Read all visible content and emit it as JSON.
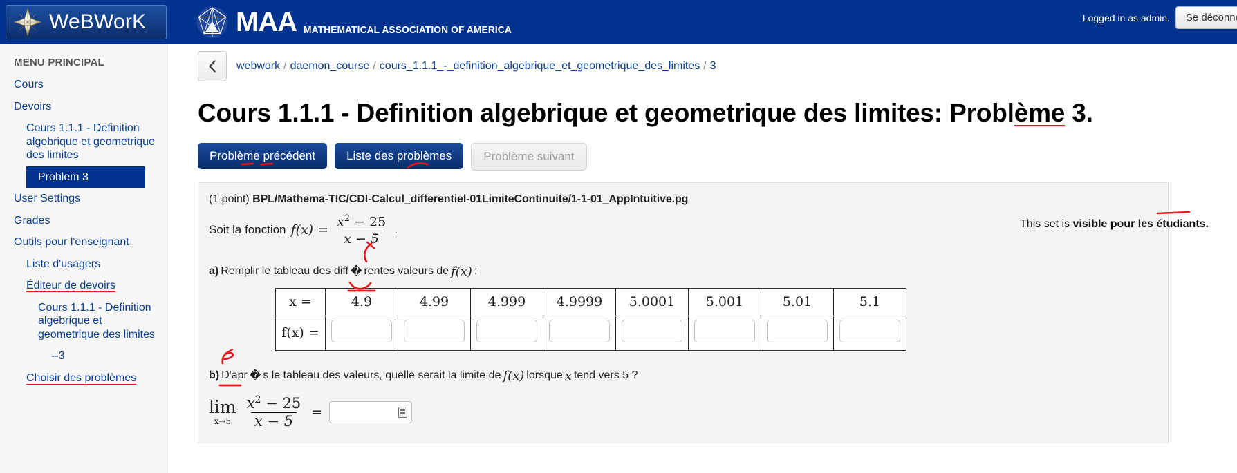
{
  "topbar": {
    "brand": "WeBWorK",
    "star_icon": "webwork-star-icon",
    "maa_letters": "MAA",
    "maa_subtitle": "MATHEMATICAL ASSOCIATION OF AMERICA",
    "logged_in_text": "Logged in as admin.",
    "logout_label": "Se déconnecter",
    "bg_color": "#00338d"
  },
  "sidebar": {
    "title": "MENU PRINCIPAL",
    "items": [
      {
        "label": "Cours",
        "level": 1,
        "active": false,
        "spell": false
      },
      {
        "label": "Devoirs",
        "level": 1,
        "active": false,
        "spell": false
      },
      {
        "label": "Cours 1.1.1 - Definition algebrique et geometrique des limites",
        "level": 2,
        "active": false,
        "spell": false
      },
      {
        "label": "Problem 3",
        "level": 3,
        "active": true,
        "spell": false
      },
      {
        "label": "User Settings",
        "level": 1,
        "active": false,
        "spell": false
      },
      {
        "label": "Grades",
        "level": 1,
        "active": false,
        "spell": false
      },
      {
        "label": "Outils pour l'enseignant",
        "level": 1,
        "active": false,
        "spell": false
      },
      {
        "label": "Liste d'usagers",
        "level": 2,
        "active": false,
        "spell": false
      },
      {
        "label": "Éditeur de devoirs",
        "level": 2,
        "active": false,
        "spell": true
      },
      {
        "label": "Cours 1.1.1 - Definition algebrique et geometrique des limites",
        "level": 3,
        "active": false,
        "spell": false
      },
      {
        "label": "--3",
        "level": 4,
        "active": false,
        "spell": false
      },
      {
        "label": "Choisir des problèmes",
        "level": 2,
        "active": false,
        "spell": true
      }
    ]
  },
  "breadcrumb": {
    "back_icon": "chevron-left-icon",
    "parts": [
      "webwork",
      "daemon_course",
      "cours_1.1.1_-_definition_algebrique_et_geometrique_des_limites",
      "3"
    ],
    "separator": "/"
  },
  "page": {
    "title_plain": "Cours 1.1.1 - Definition algebrique et geometrique des limites: Probl",
    "title_spell": "ème",
    "title_tail": " 3."
  },
  "toolbar": {
    "prev_label": "Problème précédent",
    "list_label": "Liste des problèmes",
    "next_label": "Problème suivant",
    "next_disabled": true,
    "primary_color": "#123e85"
  },
  "status": {
    "prefix": "This set is ",
    "strong": "visible pour les étudiants."
  },
  "problem": {
    "points": "(1 point)",
    "source_file": "BPL/Mathema-TIC/CDI-Calcul_differentiel-01LimiteContinuite/1-1-01_AppIntuitive.pg",
    "intro_prefix": "Soit la fonction",
    "fn_name": "f(x) =",
    "fn_num_base": "x",
    "fn_num_exp": "2",
    "fn_num_rest": " − 25",
    "fn_den": "x − 5",
    "intro_suffix": ".",
    "part_a": {
      "label": "a)",
      "text_before": "Remplir le tableau des diff",
      "bad_char": "�",
      "text_after": "rentes valeurs de",
      "math": "f(x)",
      "colon": ":"
    },
    "table": {
      "row_header_x": "x =",
      "row_header_fx": "f(x) =",
      "x_values": [
        "4.9",
        "4.99",
        "4.999",
        "4.9999",
        "5.0001",
        "5.001",
        "5.01",
        "5.1"
      ],
      "fx_values": [
        "",
        "",
        "",
        "",
        "",
        "",
        "",
        ""
      ],
      "fx_placeholder": ""
    },
    "part_b": {
      "label": "b)",
      "text_before": "D'apr",
      "bad_char": "�",
      "text_after": "s le tableau des valeurs, quelle serait la limite de",
      "math": "f(x)",
      "text_mid": "lorsque",
      "math2": "x",
      "text_end": "tend vers 5 ?",
      "lim_word": "lim",
      "lim_sub": "x→5",
      "num_base": "x",
      "num_exp": "2",
      "num_rest": " − 25",
      "den": "x − 5",
      "equals": "=",
      "answer_value": "",
      "keyboard_icon": "math-keyboard-icon"
    }
  },
  "annotations": [
    {
      "name": "accent-mark-over-menu",
      "glyph": "é"
    },
    {
      "name": "accent-mark-part-a",
      "glyph": "é"
    },
    {
      "name": "accent-mark-part-b",
      "glyph": "è"
    }
  ]
}
